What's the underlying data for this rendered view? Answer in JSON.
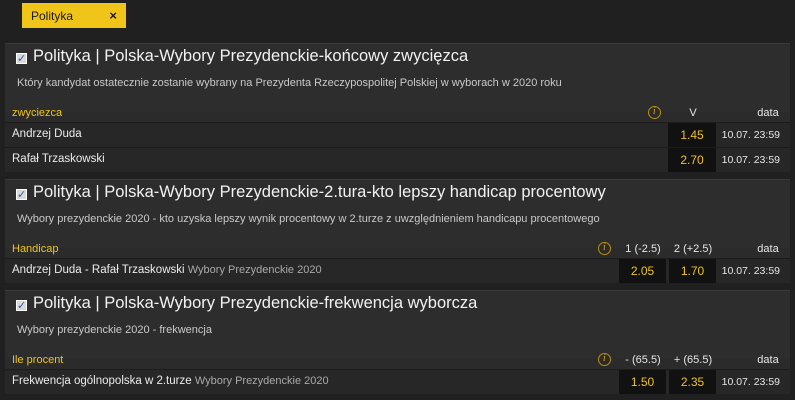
{
  "filter": {
    "chip_label": "Polityka",
    "close_symbol": "×"
  },
  "sections": [
    {
      "title": "Polityka | Polska-Wybory Prezydenckie-końcowy zwycięzca",
      "description": "Który kandydat ostatecznie zostanie wybrany na Prezydenta Rzeczypospolitej Polskiej w wyborach w 2020 roku",
      "header_label": "zwyciezca",
      "columns": [
        "V"
      ],
      "date_header": "data",
      "rows": [
        {
          "label": "Andrzej Duda",
          "sub": "",
          "odds": [
            "1.45"
          ],
          "date": "10.07. 23:59"
        },
        {
          "label": "Rafał Trzaskowski",
          "sub": "",
          "odds": [
            "2.70"
          ],
          "date": "10.07. 23:59"
        }
      ]
    },
    {
      "title": "Polityka | Polska-Wybory Prezydenckie-2.tura-kto lepszy handicap procentowy",
      "description": "Wybory prezydenckie 2020 - kto uzyska lepszy wynik procentowy w 2.turze z uwzględnieniem handicapu procentowego",
      "header_label": "Handicap",
      "columns": [
        "1 (-2.5)",
        "2 (+2.5)"
      ],
      "date_header": "data",
      "rows": [
        {
          "label": "Andrzej Duda - Rafał Trzaskowski",
          "sub": "Wybory Prezydenckie 2020",
          "odds": [
            "2.05",
            "1.70"
          ],
          "date": "10.07. 23:59"
        }
      ]
    },
    {
      "title": "Polityka | Polska-Wybory Prezydenckie-frekwencja wyborcza",
      "description": "Wybory prezydenckie 2020 - frekwencja",
      "header_label": "Ile procent",
      "columns": [
        "- (65.5)",
        "+ (65.5)"
      ],
      "date_header": "data",
      "rows": [
        {
          "label": "Frekwencja ogólnopolska w 2.turze",
          "sub": "Wybory Prezydenckie 2020",
          "odds": [
            "1.50",
            "2.35"
          ],
          "date": "10.07. 23:59"
        }
      ]
    }
  ]
}
